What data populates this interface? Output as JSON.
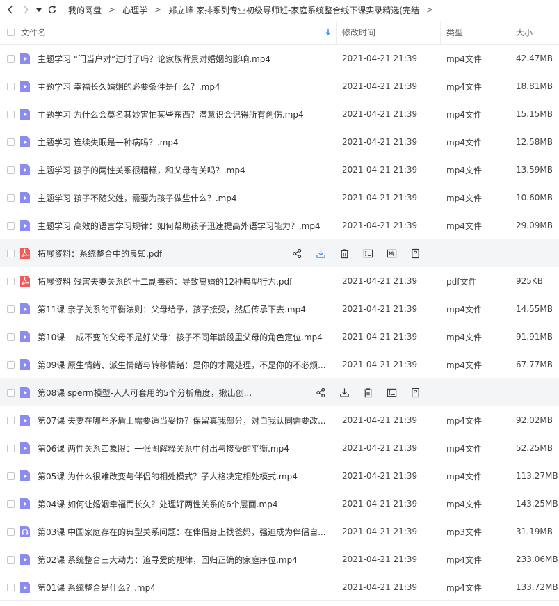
{
  "colors": {
    "video_icon": "#8c8cf0",
    "pdf_icon": "#f25a5a",
    "audio_icon": "#8c8cf0",
    "action_blue": "#3b8ef0",
    "sort_blue": "#2f8cf2"
  },
  "breadcrumb": {
    "items": [
      "我的网盘",
      "心理学",
      "郑立峰 家排系列专业初级导师班-家庭系统整合线下课实录精选(完结"
    ],
    "separator": ">"
  },
  "header": {
    "name": "文件名",
    "time": "修改时间",
    "type": "类型",
    "size": "大小"
  },
  "files": [
    {
      "icon": "video",
      "name": "主题学习 “门当户对”过时了吗？论家族背景对婚姻的影响.mp4",
      "time": "2021-04-21 21:39",
      "type": "mp4文件",
      "size": "42.47MB"
    },
    {
      "icon": "video",
      "name": "主题学习 幸福长久婚姻的必要条件是什么？.mp4",
      "time": "2021-04-21 21:39",
      "type": "mp4文件",
      "size": "18.81MB"
    },
    {
      "icon": "video",
      "name": "主题学习 为什么会莫名其妙害怕某些东西？潜意识会记得所有创伤.mp4",
      "time": "2021-04-21 21:39",
      "type": "mp4文件",
      "size": "15.15MB"
    },
    {
      "icon": "video",
      "name": "主题学习 连续失眠是一种病吗？.mp4",
      "time": "2021-04-21 21:39",
      "type": "mp4文件",
      "size": "12.58MB"
    },
    {
      "icon": "video",
      "name": "主题学习 孩子的两性关系很糟糕，和父母有关吗？.mp4",
      "time": "2021-04-21 21:39",
      "type": "mp4文件",
      "size": "13.59MB"
    },
    {
      "icon": "video",
      "name": "主题学习 孩子不随父姓，需要为孩子做些什么？.mp4",
      "time": "2021-04-21 21:39",
      "type": "mp4文件",
      "size": "10.60MB"
    },
    {
      "icon": "video",
      "name": "主题学习 高效的语言学习规律：如何帮助孩子迅速提高外语学习能力？.mp4",
      "time": "2021-04-21 21:39",
      "type": "mp4文件",
      "size": "29.09MB"
    },
    {
      "icon": "pdf",
      "name": "拓展资料：系统整合中的良知.pdf",
      "time": "",
      "type": "",
      "size": "",
      "hover": true
    },
    {
      "icon": "pdf",
      "name": "拓展资料 残害夫妻关系的十二副毒药：导致离婚的12种典型行为.pdf",
      "time": "2021-04-21 21:39",
      "type": "pdf文件",
      "size": "925KB"
    },
    {
      "icon": "video",
      "name": "第11课 亲子关系的平衡法则：父母给予，孩子接受，然后传承下去.mp4",
      "time": "2021-04-21 21:39",
      "type": "mp4文件",
      "size": "14.55MB"
    },
    {
      "icon": "video",
      "name": "第10课 一成不变的父母不是好父母：孩子不同年龄段里父母的角色定位.mp4",
      "time": "2021-04-21 21:39",
      "type": "mp4文件",
      "size": "91.91MB"
    },
    {
      "icon": "video",
      "name": "第09课 原生情绪、派生情绪与转移情绪：是你的才需处理，不是你的不必烦...",
      "time": "2021-04-21 21:39",
      "type": "mp4文件",
      "size": "67.77MB"
    },
    {
      "icon": "video",
      "name": "第08课 sperm模型-人人可套用的5个分析角度，揪出创...",
      "time": "",
      "type": "",
      "size": "",
      "hover": true
    },
    {
      "icon": "video",
      "name": "第07课 夫妻在哪些矛盾上需要适当妥协？保留真我部分，对自我认同需要改...",
      "time": "2021-04-21 21:39",
      "type": "mp4文件",
      "size": "92.02MB"
    },
    {
      "icon": "video",
      "name": "第06课 两性关系四象限：一张图解释关系中付出与接受的平衡.mp4",
      "time": "2021-04-21 21:39",
      "type": "mp4文件",
      "size": "52.25MB"
    },
    {
      "icon": "video",
      "name": "第05课 为什么很难改变与伴侣的相处模式？子人格决定相处模式.mp4",
      "time": "2021-04-21 21:39",
      "type": "mp4文件",
      "size": "113.27MB"
    },
    {
      "icon": "video",
      "name": "第04课 如何让婚姻幸福而长久？处理好两性关系的6个层面.mp4",
      "time": "2021-04-21 21:39",
      "type": "mp4文件",
      "size": "143.25MB"
    },
    {
      "icon": "audio",
      "name": "第03课 中国家庭存在的典型关系问题：在伴侣身上找爸妈，强迫成为伴侣自...",
      "time": "2021-04-21 21:39",
      "type": "mp3文件",
      "size": "31.19MB"
    },
    {
      "icon": "video",
      "name": "第02课 系统整合三大动力：追寻爱的规律，回归正确的家庭序位.mp4",
      "time": "2021-04-21 21:39",
      "type": "mp4文件",
      "size": "233.06MB"
    },
    {
      "icon": "video",
      "name": "第01课 系统整合是什么？.mp4",
      "time": "2021-04-21 21:39",
      "type": "mp4文件",
      "size": "133.72MB"
    }
  ]
}
